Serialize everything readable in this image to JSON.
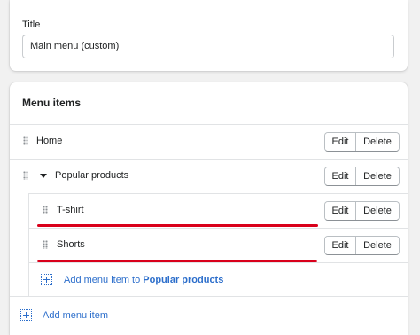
{
  "title_card": {
    "label": "Title",
    "value": "Main menu (custom)"
  },
  "menu_card": {
    "heading": "Menu items",
    "items": [
      {
        "label": "Home",
        "edit": "Edit",
        "delete": "Delete"
      },
      {
        "label": "Popular products",
        "edit": "Edit",
        "delete": "Delete"
      },
      {
        "label": "T-shirt",
        "edit": "Edit",
        "delete": "Delete"
      },
      {
        "label": "Shorts",
        "edit": "Edit",
        "delete": "Delete"
      }
    ],
    "add_child_prefix": "Add menu item to ",
    "add_child_target": "Popular products",
    "add_item": "Add menu item"
  },
  "colors": {
    "link": "#2c6ecb",
    "annotation_underline": "#d9001b"
  },
  "icons": {
    "drag": "drag-handle-icon",
    "expand": "caret-down-icon",
    "add": "add-item-icon"
  }
}
